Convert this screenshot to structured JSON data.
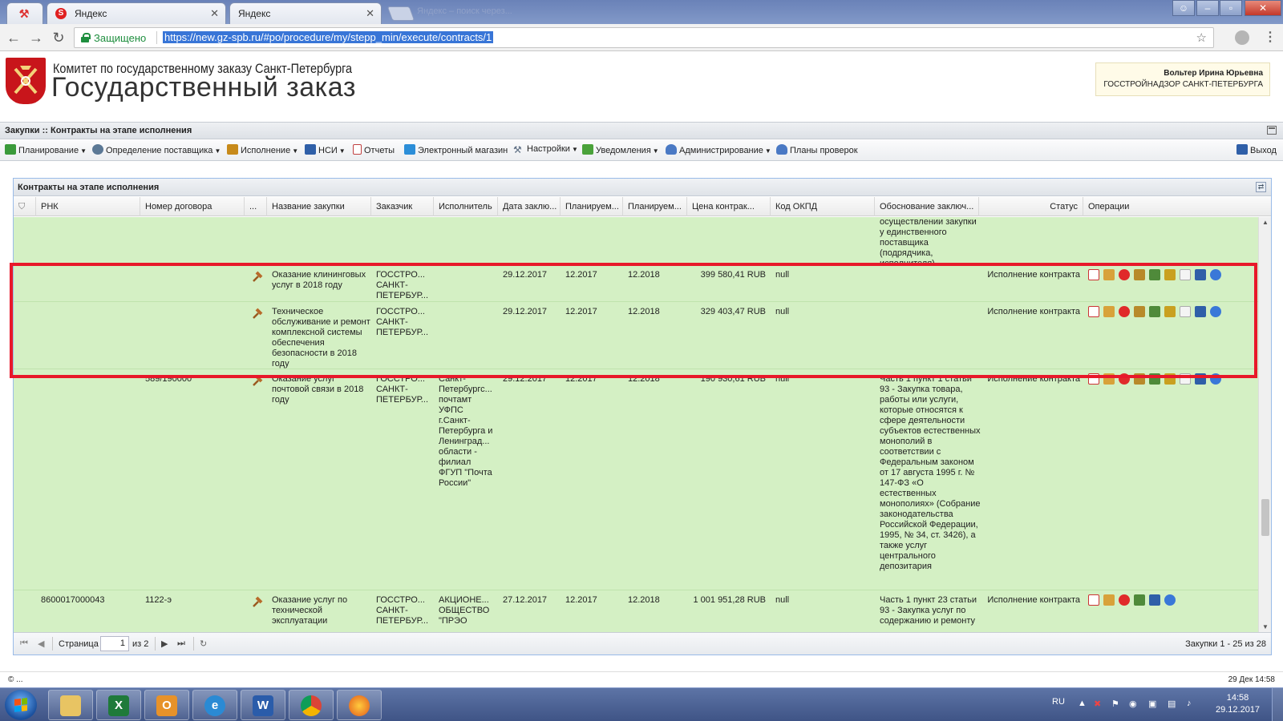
{
  "browser": {
    "tabs": [
      {
        "label": ""
      },
      {
        "label": "Яндекс"
      },
      {
        "label": "Яндекс"
      }
    ],
    "faded_tab_text": "Яндекс – поиск через...",
    "secure_label": "Защищено",
    "url": "https://new.gz-spb.ru/#po/procedure/my/stepp_min/execute/contracts/1"
  },
  "site": {
    "org_name": "Комитет по государственному заказу Санкт-Петербурга",
    "brand": "Государственный заказ",
    "user_name": "Вольтер Ирина Юрьевна",
    "user_dept": "ГОССТРОЙНАДЗОР САНКТ-ПЕТЕРБУРГА"
  },
  "app": {
    "title": "Закупки :: Контракты на этапе исполнения",
    "menu": [
      {
        "label": "Планирование",
        "dropdown": true,
        "icon": "planning-icon",
        "color": "#3a9a3a"
      },
      {
        "label": "Определение поставщика",
        "dropdown": true,
        "icon": "gears-icon",
        "color": "#5b7895"
      },
      {
        "label": "Исполнение",
        "dropdown": true,
        "icon": "execution-icon",
        "color": "#c78a1a"
      },
      {
        "label": "НСИ",
        "dropdown": true,
        "icon": "book-icon",
        "color": "#2f5fa8"
      },
      {
        "label": "Отчеты",
        "dropdown": false,
        "icon": "report-icon",
        "color": "#c04040"
      },
      {
        "label": "Электронный магазин",
        "dropdown": false,
        "icon": "cart-icon",
        "color": "#2c8ed8"
      },
      {
        "label": "Настройки",
        "dropdown": true,
        "icon": "wrench-icon",
        "color": "#5a6b80"
      },
      {
        "label": "Уведомления",
        "dropdown": true,
        "icon": "notification-icon",
        "color": "#4aa23a"
      },
      {
        "label": "Администрирование",
        "dropdown": true,
        "icon": "admin-user-icon",
        "color": "#4a79c4"
      },
      {
        "label": "Планы проверок",
        "dropdown": false,
        "icon": "inspection-user-icon",
        "color": "#4a79c4"
      }
    ],
    "exit_label": "Выход"
  },
  "panel": {
    "title": "Контракты на этапе исполнения",
    "columns": [
      {
        "label": ""
      },
      {
        "label": "РНК"
      },
      {
        "label": "Номер договора"
      },
      {
        "label": "..."
      },
      {
        "label": "Название закупки"
      },
      {
        "label": "Заказчик"
      },
      {
        "label": "Исполнитель"
      },
      {
        "label": "Дата заклю..."
      },
      {
        "label": "Планируем..."
      },
      {
        "label": "Планируем..."
      },
      {
        "label": "Цена контрак..."
      },
      {
        "label": "Код ОКПД"
      },
      {
        "label": "Обоснование заключ..."
      },
      {
        "label": "Статус"
      },
      {
        "label": "Операции"
      }
    ],
    "rows": [
      {
        "rnk": "",
        "number": "",
        "gavel": false,
        "name": "",
        "customer": "",
        "executor": "",
        "date": "",
        "plan1": "",
        "plan2": "",
        "price": "",
        "okpd": "",
        "basis": "осуществлении закупки у единственного поставщика (подрядчика, исполнителя)",
        "status": "",
        "ops": 0
      },
      {
        "rnk": "",
        "number": "",
        "gavel": true,
        "name": "Оказание клининговых услуг в 2018 году",
        "customer": "ГОССТРО... САНКТ-ПЕТЕРБУР...",
        "executor": "",
        "date": "29.12.2017",
        "plan1": "12.2017",
        "plan2": "12.2018",
        "price": "399 580,41 RUB",
        "okpd": "null",
        "basis": "",
        "status": "Исполнение контракта",
        "ops": 9
      },
      {
        "rnk": "",
        "number": "",
        "gavel": true,
        "name": "Техническое обслуживание и ремонт комплексной системы обеспечения безопасности в 2018 году",
        "customer": "ГОССТРО... САНКТ-ПЕТЕРБУР...",
        "executor": "",
        "date": "29.12.2017",
        "plan1": "12.2017",
        "plan2": "12.2018",
        "price": "329 403,47 RUB",
        "okpd": "null",
        "basis": "",
        "status": "Исполнение контракта",
        "ops": 9
      },
      {
        "rnk": "",
        "number": "589/190000",
        "gavel": true,
        "name": "Оказание услуг почтовой связи в 2018 году",
        "customer": "ГОССТРО... САНКТ-ПЕТЕРБУР...",
        "executor": "Санкт-Петербургс... почтамт УФПС г.Санкт-Петербурга и Ленинград... области - филиал ФГУП \"Почта России\"",
        "date": "29.12.2017",
        "plan1": "12.2017",
        "plan2": "12.2018",
        "price": "190 930,61 RUB",
        "okpd": "null",
        "basis": "Часть 1 пункт 1 статьи 93 - Закупка товара, работы или услуги, которые относятся к сфере деятельности субъектов естественных монополий в соответствии с Федеральным законом от 17 августа 1995 г. № 147-ФЗ «О естественных монополиях» (Собрание законодательства Российской Федерации, 1995, № 34, ст. 3426), а также услуг центрального депозитария",
        "status": "Исполнение контракта",
        "ops": 9
      },
      {
        "rnk": "8600017000043",
        "number": "1122-э",
        "gavel": true,
        "name": "Оказание услуг по технической эксплуатации",
        "customer": "ГОССТРО... САНКТ-ПЕТЕРБУР...",
        "executor": "АКЦИОНЕ... ОБЩЕСТВО \"ПРЭО",
        "date": "27.12.2017",
        "plan1": "12.2017",
        "plan2": "12.2018",
        "price": "1 001 951,28 RUB",
        "okpd": "null",
        "basis": "Часть 1 пункт 23 статьи 93 - Закупка услуг по содержанию и ремонту",
        "status": "Исполнение контракта",
        "ops": 6
      }
    ],
    "pager": {
      "page_label": "Страница",
      "page_value": "1",
      "of_label": "из 2",
      "info": "Закупки 1 - 25 из 28"
    }
  },
  "footer": {
    "left": "© ...",
    "right": "29 Дек 14:58"
  },
  "taskbar": {
    "lang": "RU",
    "time": "14:58",
    "date": "29.12.2017"
  }
}
